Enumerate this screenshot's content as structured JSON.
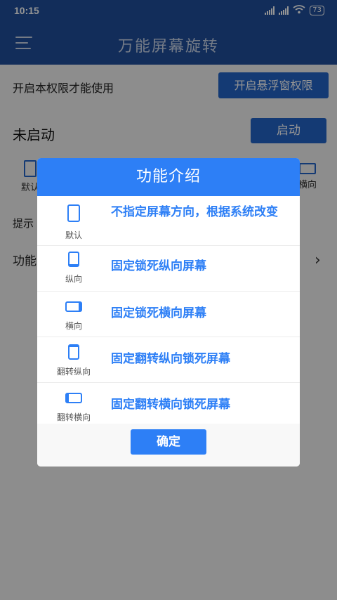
{
  "status": {
    "time": "10:15",
    "battery": "73"
  },
  "app": {
    "title": "万能屏幕旋转"
  },
  "main": {
    "permission_text": "开启本权限才能使用",
    "float_button": "开启悬浮窗权限",
    "state_text": "未启动",
    "start_button": "启动",
    "modes": [
      "默认",
      "横向"
    ],
    "hint": "提示",
    "func": "功能",
    "chevron": "›"
  },
  "dialog": {
    "title": "功能介绍",
    "items": [
      {
        "icon": "phone-outline-icon",
        "label": "默认",
        "desc": "不指定屏幕方向，根据系统改变"
      },
      {
        "icon": "phone-portrait-icon",
        "label": "纵向",
        "desc": "固定锁死纵向屏幕"
      },
      {
        "icon": "phone-landscape-icon",
        "label": "横向",
        "desc": "固定锁死横向屏幕"
      },
      {
        "icon": "phone-portrait-flip-icon",
        "label": "翻转纵向",
        "desc": "固定翻转纵向锁死屏幕"
      },
      {
        "icon": "phone-landscape-flip-icon",
        "label": "翻转横向",
        "desc": "固定翻转横向锁死屏幕"
      }
    ],
    "ok_button": "确定"
  },
  "colors": {
    "appbar": "#1f4f9c",
    "accent": "#2d7ff6",
    "button": "#2464c8"
  }
}
